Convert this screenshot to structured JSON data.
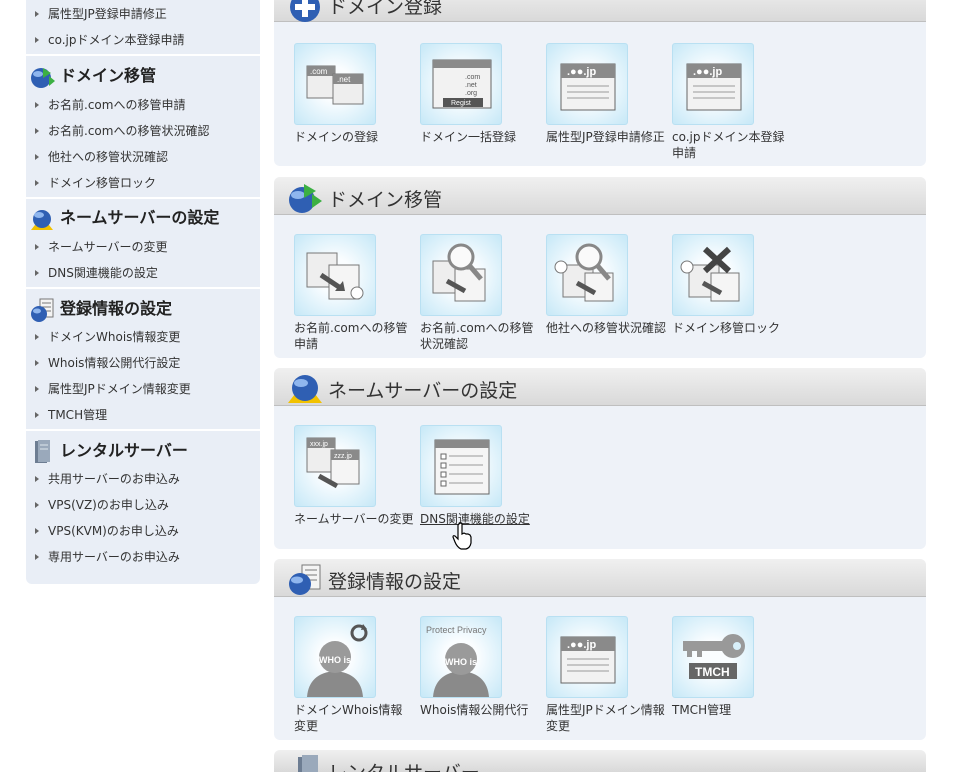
{
  "sidebar": {
    "groups": [
      {
        "title": "",
        "items": [
          "属性型JP登録申請修正",
          "co.jpドメイン本登録申請"
        ]
      },
      {
        "title": "ドメイン移管",
        "icon": "globe-arrows-icon",
        "items": [
          "お名前.comへの移管申請",
          "お名前.comへの移管状況確認",
          "他社への移管状況確認",
          "ドメイン移管ロック"
        ]
      },
      {
        "title": "ネームサーバーの設定",
        "icon": "globe-nameserver-icon",
        "items": [
          "ネームサーバーの変更",
          "DNS関連機能の設定"
        ]
      },
      {
        "title": "登録情報の設定",
        "icon": "globe-document-icon",
        "items": [
          "ドメインWhois情報変更",
          "Whois情報公開代行設定",
          "属性型JPドメイン情報変更",
          "TMCH管理"
        ]
      },
      {
        "title": "レンタルサーバー",
        "icon": "server-icon",
        "items": [
          "共用サーバーのお申込み",
          "VPS(VZ)のお申し込み",
          "VPS(KVM)のお申し込み",
          "専用サーバーのお申込み"
        ]
      }
    ]
  },
  "sections": [
    {
      "title": "ドメイン登録",
      "icon": "plus-globe-icon",
      "tiles": [
        {
          "label": "ドメインの登録",
          "icon": "domain-register-icon",
          "art": [
            ".com",
            ".net"
          ]
        },
        {
          "label": "ドメイン一括登録",
          "icon": "bulk-register-icon",
          "art": [
            ".com",
            ".net",
            ".org",
            "Regist"
          ]
        },
        {
          "label": "属性型JP登録申請修正",
          "icon": "jp-document-icon",
          "art": [
            ".●●.jp"
          ]
        },
        {
          "label": "co.jpドメイン本登録申請",
          "icon": "cojp-document-icon",
          "art": [
            ".●●.jp"
          ]
        }
      ]
    },
    {
      "title": "ドメイン移管",
      "icon": "globe-arrows-icon",
      "tiles": [
        {
          "label": "お名前.comへの移管申請",
          "icon": "transfer-in-icon"
        },
        {
          "label": "お名前.comへの移管状況確認",
          "icon": "transfer-status-icon"
        },
        {
          "label": "他社への移管状況確認",
          "icon": "transfer-out-status-icon"
        },
        {
          "label": "ドメイン移管ロック",
          "icon": "transfer-lock-icon"
        }
      ]
    },
    {
      "title": "ネームサーバーの設定",
      "icon": "globe-nameserver-icon",
      "tiles": [
        {
          "label": "ネームサーバーの変更",
          "icon": "nameserver-change-icon",
          "art": [
            "xxx.jp",
            "zzz.jp"
          ]
        },
        {
          "label": "DNS関連機能の設定",
          "icon": "dns-settings-icon",
          "hovered": true
        }
      ]
    },
    {
      "title": "登録情報の設定",
      "icon": "globe-document-icon",
      "tiles": [
        {
          "label": "ドメインWhois情報変更",
          "icon": "whois-change-icon",
          "art": [
            "WHO is"
          ]
        },
        {
          "label": "Whois情報公開代行",
          "icon": "whois-privacy-icon",
          "art": [
            "Protect Privacy",
            "WHO is"
          ]
        },
        {
          "label": "属性型JPドメイン情報変更",
          "icon": "jp-info-change-icon",
          "art": [
            ".●●.jp"
          ]
        },
        {
          "label": "TMCH管理",
          "icon": "tmch-key-icon",
          "art": [
            "TMCH"
          ]
        }
      ]
    },
    {
      "title": "レンタルサーバー",
      "icon": "server-icon",
      "tiles": []
    }
  ],
  "colors": {
    "tile_glow": "#c6e8f7",
    "panel_bg": "#eef2f8",
    "sidebar_bg": "#e9eef6"
  }
}
